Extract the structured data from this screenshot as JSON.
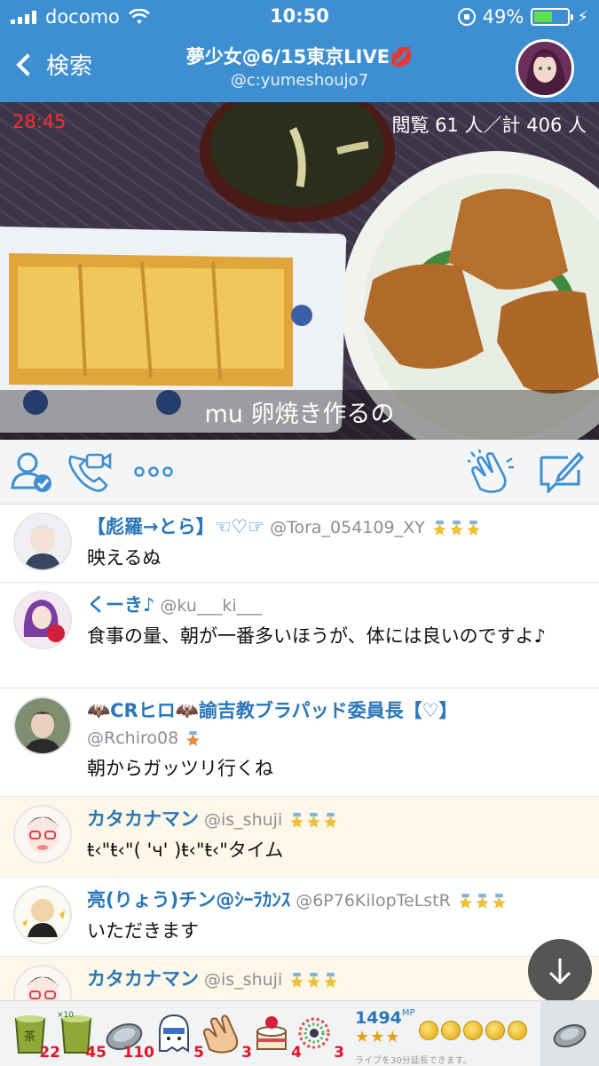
{
  "status": {
    "carrier": "docomo",
    "time": "10:50",
    "battery": "49%"
  },
  "nav": {
    "back_label": "検索",
    "title": "夢少女@6/15東京LIVE💋",
    "subtitle": "@c:yumeshoujo7"
  },
  "video": {
    "timer": "28:45",
    "viewers": "閲覧 61 人／計 406 人",
    "caption": "mu 卵焼き作るの"
  },
  "comments": [
    {
      "name": "【彪羅→とら】☜♡☞",
      "id": "@Tora_054109_XY",
      "stars": 3,
      "star_color": "#f0c030",
      "text": "映えるぬ",
      "highlight": false,
      "avatar_color": "#d8dce2"
    },
    {
      "name": "くーき♪",
      "id": "@ku___ki___",
      "stars": 0,
      "text": "食事の量、朝が一番多いほうが、体には良いのですよ♪",
      "highlight": false,
      "avatar_color": "#c9a2d6"
    },
    {
      "name": "🦇CRヒロ🦇諭吉教ブラパッド委員長【♡】",
      "id": "@Rchiro08",
      "stars": 1,
      "star_color": "#e58b3a",
      "text": "朝からガッツリ行くね",
      "highlight": false,
      "avatar_color": "#6c7a5e"
    },
    {
      "name": "カタカナマン",
      "id": "@is_shuji",
      "stars": 3,
      "star_color": "#e9c13a",
      "text": "ŧ‹\"ŧ‹\"( 'ч' )ŧ‹\"ŧ‹\"タイム",
      "highlight": true,
      "avatar_color": "#f3f0ee"
    },
    {
      "name": "亮(りょう)チン@ｼｰﾗｶﾝｽ",
      "id": "@6P76KilopTeLstR",
      "stars": 3,
      "star_color": "#e9c13a",
      "text": "いただきます",
      "highlight": false,
      "avatar_color": "#f5f3e8"
    },
    {
      "name": "カタカナマン",
      "id": "@is_shuji",
      "stars": 3,
      "star_color": "#e9c13a",
      "text": "",
      "highlight": true,
      "avatar_color": "#f3f0ee"
    }
  ],
  "gifts": [
    {
      "icon": "tea-icon",
      "count": "22"
    },
    {
      "icon": "tea-x10-icon",
      "count": "45"
    },
    {
      "icon": "coin-silver-icon",
      "count": "110"
    },
    {
      "icon": "ghost-icon",
      "count": "5"
    },
    {
      "icon": "clap-icon",
      "count": "3"
    },
    {
      "icon": "cake-icon",
      "count": "4"
    },
    {
      "icon": "firework-icon",
      "count": "3"
    }
  ],
  "mp": {
    "value": "1494",
    "unit": "MP",
    "rank_stars": "★★★",
    "note": "ライブを30分延長できます。"
  },
  "colors": {
    "accent": "#3d8fd1",
    "name": "#2a76b8",
    "timer": "#ff2b2b",
    "gift_count": "#e0162b"
  }
}
